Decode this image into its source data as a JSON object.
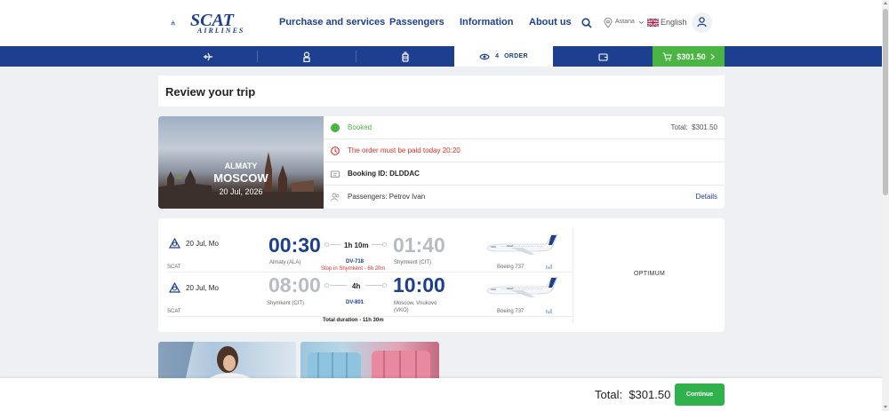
{
  "header": {
    "logo_text": "SCAT",
    "logo_sub": "AIRLINES",
    "nav": [
      "Purchase and services",
      "Passengers",
      "Information",
      "About us"
    ],
    "city": "Astana",
    "language": "English"
  },
  "steps": {
    "active_number": "4",
    "active_label": "ORDER",
    "price": "$301.50"
  },
  "review_title": "Review your trip",
  "booking": {
    "from_city": "ALMATY",
    "to_city": "MOSCOW",
    "date": "20 Jul, 2026",
    "status": "Booked",
    "total_label": "Total:",
    "total_value": "$301.50",
    "warning": "The order must be paid today 20:20",
    "booking_id": "Booking ID: DLDDAC",
    "passengers": "Passengers: Petrov Ivan",
    "details_label": "Details"
  },
  "itinerary": {
    "legs": [
      {
        "date": "20 Jul, Mo",
        "airline": "SCAT",
        "dep_time": "00:30",
        "dep_airport": "Almaty (ALA)",
        "duration": "1h 10m",
        "flight": "DV-718",
        "stop": "Stop in Shymkent - 6h 20m",
        "arr_time": "01:40",
        "arr_airport": "Shymkent (CIT)",
        "aircraft": "Boeing 737"
      },
      {
        "date": "20 Jul, Mo",
        "airline": "SCAT",
        "dep_time": "08:00",
        "dep_airport": "Shymkent (CIT)",
        "duration": "4h",
        "flight": "DV-801",
        "stop": "",
        "arr_time": "10:00",
        "arr_airport_1": "Moscow, Vnukovo",
        "arr_airport_2": "(VKO)",
        "aircraft": "Boeing 737"
      }
    ],
    "fare": "OPTIMUM",
    "total_duration": "Total duration - 11h 30m"
  },
  "bottom": {
    "total_label": "Total:",
    "total_value": "$301.50",
    "continue_label": "Continue"
  },
  "colors": {
    "brand_blue": "#1d3f8f",
    "green": "#4bb543",
    "warning_red": "#d9302c"
  }
}
